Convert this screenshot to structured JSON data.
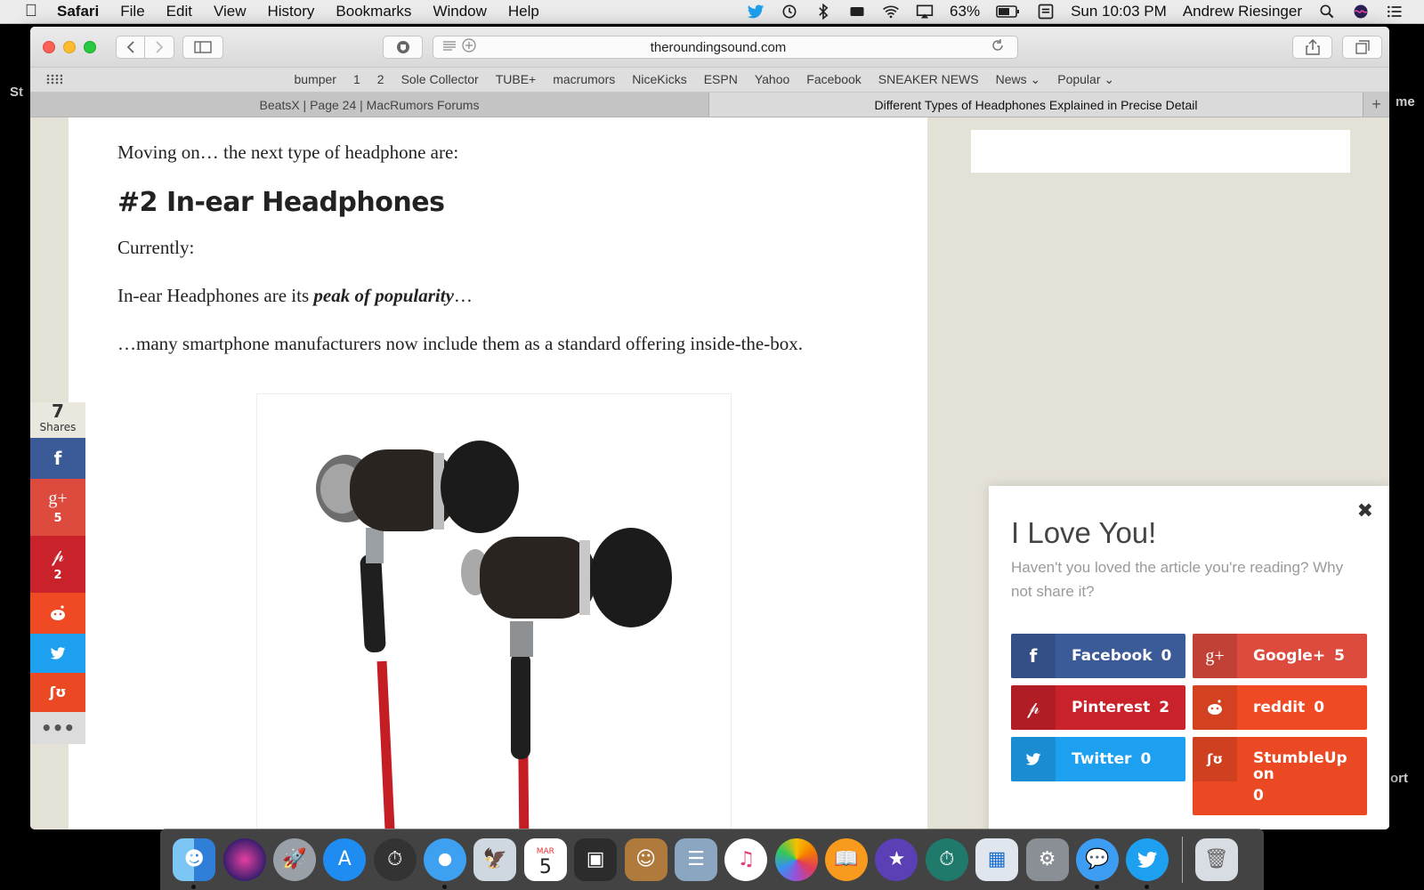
{
  "menubar": {
    "app": "Safari",
    "items": [
      "File",
      "Edit",
      "View",
      "History",
      "Bookmarks",
      "Window",
      "Help"
    ],
    "battery": "63%",
    "clock": "Sun 10:03 PM",
    "user": "Andrew Riesinger"
  },
  "desktop": {
    "left_text": "St",
    "right_text_1": "me",
    "right_text_2": "ort"
  },
  "browser": {
    "url": "theroundingsound.com",
    "favorites": [
      "bumper",
      "1",
      "2",
      "Sole Collector",
      "TUBE+",
      "macrumors",
      "NiceKicks",
      "ESPN",
      "Yahoo",
      "Facebook",
      "SNEAKER NEWS",
      "News",
      "Popular"
    ],
    "tabs": [
      {
        "title": "BeatsX | Page 24 | MacRumors Forums",
        "active": false
      },
      {
        "title": "Different Types of Headphones Explained in Precise Detail",
        "active": true
      }
    ]
  },
  "article": {
    "intro": "Moving on… the next type of headphone are:",
    "heading": "#2 In-ear Headphones",
    "currently": "Currently:",
    "popular_before": "In-ear Headphones are its ",
    "popular_em": "peak of popularity",
    "popular_after": "…",
    "smartphones": "…many smartphone manufacturers now include them as a standard offering inside-the-box."
  },
  "sharebar": {
    "total": "7",
    "total_label": "Shares",
    "googleplus_count": "5",
    "pinterest_count": "2"
  },
  "popup": {
    "title": "I Love You!",
    "subtitle": "Haven't you loved the article you're reading? Why not share it?",
    "buttons": [
      {
        "label": "Facebook",
        "count": "0"
      },
      {
        "label": "Google+",
        "count": "5"
      },
      {
        "label": "Pinterest",
        "count": "2"
      },
      {
        "label": "reddit",
        "count": "0"
      },
      {
        "label": "Twitter",
        "count": "0"
      },
      {
        "label": "StumbleUpon",
        "label_line1": "StumbleUp",
        "label_line2": "on",
        "count": "0"
      }
    ]
  },
  "dock": {
    "calendar_month": "MAR",
    "calendar_day": "5",
    "apps": [
      "finder",
      "siri",
      "launchpad",
      "app-store",
      "dashboard",
      "safari",
      "preview",
      "calendar",
      "photo-booth",
      "contacts",
      "image-capture",
      "itunes",
      "photos",
      "ibooks",
      "imovie",
      "time-machine",
      "keynote",
      "system-preferences",
      "messages",
      "twitter",
      "trash"
    ]
  },
  "colors": {
    "facebook": "#3b5a98",
    "googleplus": "#dc4b3e",
    "pinterest": "#c9222b",
    "reddit": "#f04a25",
    "twitter": "#1da0ef",
    "stumbleupon": "#eb4924"
  }
}
